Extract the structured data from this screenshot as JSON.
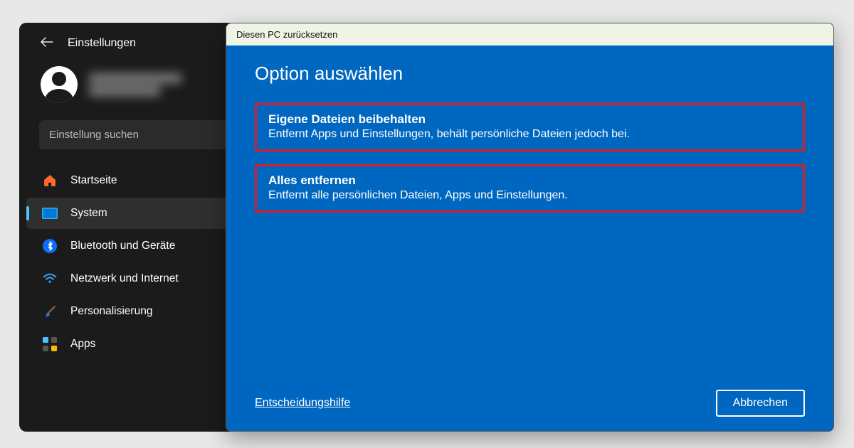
{
  "settings": {
    "title": "Einstellungen",
    "search_placeholder": "Einstellung suchen",
    "nav": [
      {
        "label": "Startseite"
      },
      {
        "label": "System"
      },
      {
        "label": "Bluetooth und Geräte"
      },
      {
        "label": "Netzwerk und Internet"
      },
      {
        "label": "Personalisierung"
      },
      {
        "label": "Apps"
      }
    ]
  },
  "dialog": {
    "window_title": "Diesen PC zurücksetzen",
    "heading": "Option auswählen",
    "options": [
      {
        "title": "Eigene Dateien beibehalten",
        "desc": "Entfernt Apps und Einstellungen, behält persönliche Dateien jedoch bei."
      },
      {
        "title": "Alles entfernen",
        "desc": "Entfernt alle persönlichen Dateien, Apps und Einstellungen."
      }
    ],
    "help_link": "Entscheidungshilfe",
    "cancel": "Abbrechen"
  }
}
